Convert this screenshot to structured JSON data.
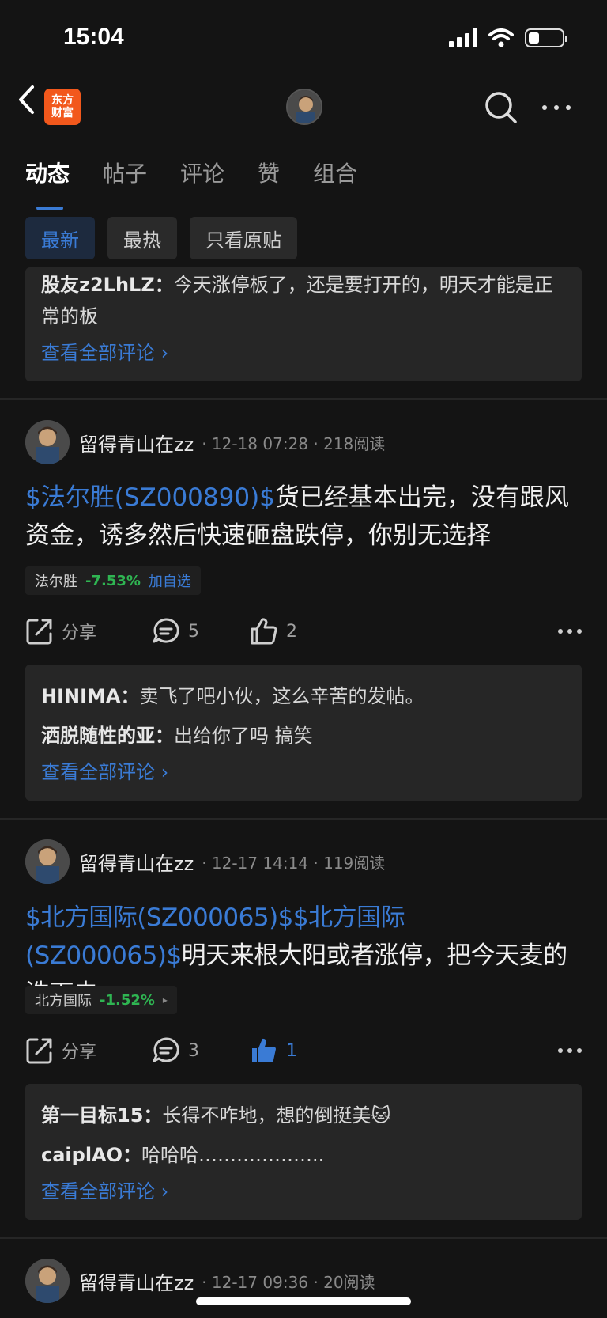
{
  "status": {
    "time": "15:04"
  },
  "nav": {
    "logo_line1": "东方",
    "logo_line2": "财富"
  },
  "tabs": [
    "动态",
    "帖子",
    "评论",
    "赞",
    "组合"
  ],
  "filters": [
    "最新",
    "最热",
    "只看原贴"
  ],
  "top_comments": {
    "comment": {
      "author": "股友z2LhLZ：",
      "text": "今天涨停板了，还是要打开的，明天才能是正常的板"
    },
    "view_all": "查看全部评论 ›"
  },
  "posts": [
    {
      "username": "留得青山在zz",
      "meta": "· 12-18 07:28 · 218阅读",
      "stock_link": "$法尔胜(SZ000890)$",
      "text": "货已经基本出完，没有跟风资金，诱多然后快速砸盘跌停，你别无选择",
      "stock_name": "法尔胜",
      "stock_pct": "-7.53%",
      "stock_action": "加自选",
      "share": "分享",
      "comments": "5",
      "likes": "2",
      "replies": [
        {
          "author": "HINIMA：",
          "text": "卖飞了吧小伙，这么辛苦的发帖。"
        },
        {
          "author": "洒脱随性的亚：",
          "text": "出给你了吗 搞笑"
        }
      ],
      "view_all": "查看全部评论 ›"
    },
    {
      "username": "留得青山在zz",
      "meta": "· 12-17 14:14 · 119阅读",
      "stock_link": "$北方国际(SZ000065)$$北方国际(SZ000065)$",
      "text": "明天来根大阳或者涨停，把今天麦的洗下去",
      "stock_name": "北方国际",
      "stock_pct": "-1.52%",
      "stock_action": "▸",
      "share": "分享",
      "comments": "3",
      "likes": "1",
      "replies": [
        {
          "author": "第一目标15：",
          "text": "长得不咋地，想的倒挺美🐱"
        },
        {
          "author": "caiplAO：",
          "text": "哈哈哈……………….."
        }
      ],
      "view_all": "查看全部评论 ›"
    },
    {
      "username": "留得青山在zz",
      "meta": "· 12-17 09:36 · 20阅读"
    }
  ],
  "colors": {
    "accent": "#3a7bd5",
    "down": "#2fb552",
    "brand": "#f2581c"
  }
}
